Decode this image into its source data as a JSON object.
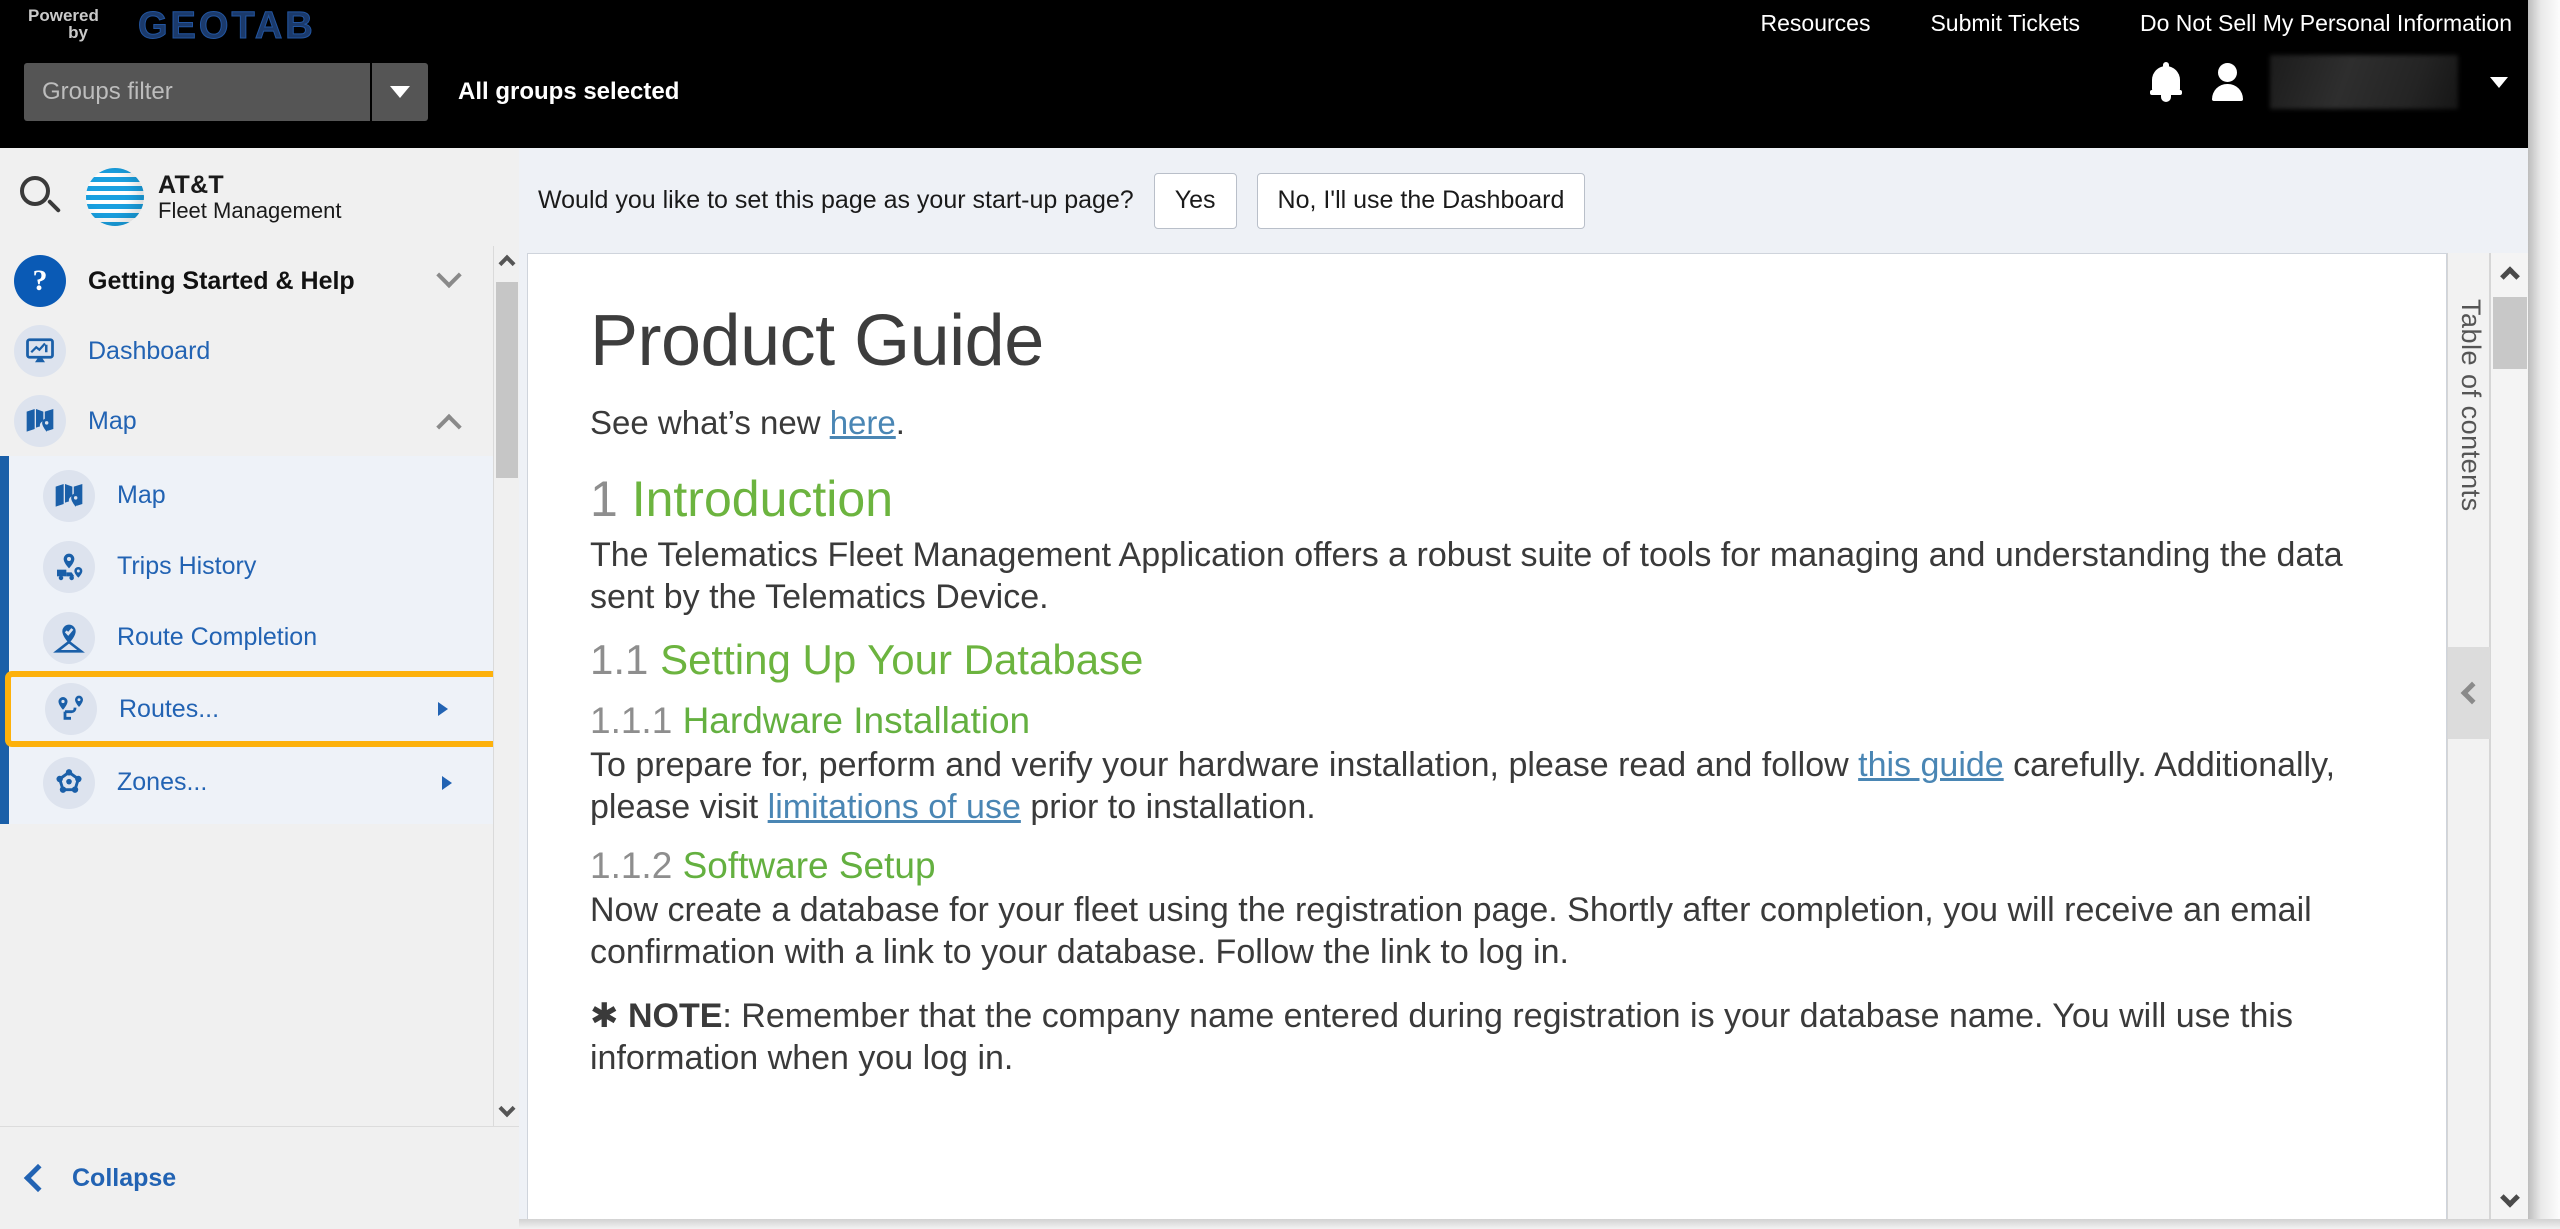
{
  "topbar": {
    "powered_line1": "Powered",
    "powered_line2": "by",
    "brand": "GEOTAB",
    "links": [
      "Resources",
      "Submit Tickets",
      "Do Not Sell My Personal Information"
    ],
    "groups_filter_placeholder": "Groups filter",
    "groups_filter_value": "",
    "groups_selected_label": "All groups selected",
    "notification_icon": "bell-icon",
    "user_icon": "person-icon",
    "user_name": ""
  },
  "sidebar": {
    "search_icon": "search-icon",
    "logo": {
      "icon": "att-globe-icon",
      "line1": "AT&T",
      "line2": "Fleet Management"
    },
    "items": [
      {
        "label": "Getting Started & Help",
        "icon": "question-circle-icon",
        "chevron": "chevron-down-icon",
        "bold": true
      },
      {
        "label": "Dashboard",
        "icon": "dashboard-icon",
        "chevron": "",
        "bold": false
      },
      {
        "label": "Map",
        "icon": "map-icon",
        "chevron": "chevron-up-icon",
        "bold": false
      }
    ],
    "submenu": [
      {
        "label": "Map",
        "icon": "map-icon",
        "arrow": ""
      },
      {
        "label": "Trips History",
        "icon": "trips-history-icon",
        "arrow": ""
      },
      {
        "label": "Route Completion",
        "icon": "route-completion-icon",
        "arrow": ""
      },
      {
        "label": "Routes...",
        "icon": "routes-icon",
        "arrow": "arrow-right-icon",
        "highlighted": true
      },
      {
        "label": "Zones...",
        "icon": "zones-icon",
        "arrow": "arrow-right-icon"
      }
    ],
    "collapse_label": "Collapse",
    "collapse_icon": "chevron-left-icon"
  },
  "startup_prompt": {
    "question": "Would you like to set this page as your start-up page?",
    "yes_label": "Yes",
    "no_label": "No, I'll use the Dashboard"
  },
  "document": {
    "title": "Product Guide",
    "subline_prefix": "See what’s new ",
    "subline_link": "here",
    "subline_suffix": ".",
    "sections": [
      {
        "number": "1",
        "title": "Introduction",
        "level": 1,
        "body": "The Telematics Fleet Management Application offers a robust suite of tools for managing and understanding the data sent by the Telematics Device."
      },
      {
        "number": "1.1",
        "title": "Setting Up Your Database",
        "level": 2,
        "body": ""
      },
      {
        "number": "1.1.1",
        "title": "Hardware Installation",
        "level": 3,
        "body_part1": "To prepare for, perform and verify your hardware installation, please read and follow ",
        "link1": "this guide",
        "body_part2": " carefully. Additionally, please visit ",
        "link2": "limitations of use",
        "body_part3": " prior to installation."
      },
      {
        "number": "1.1.2",
        "title": "Software Setup",
        "level": 3,
        "body": "Now create a database for your fleet using the registration page. Shortly after completion, you will receive an email confirmation with a link to your database. Follow the link to log in."
      }
    ],
    "note": {
      "star": "✱",
      "label": "NOTE",
      "text": ": Remember that the company name entered during registration is your database name. You will use this information when you log in."
    }
  },
  "toc": {
    "label": "Table of contents",
    "collapse_icon": "chevron-left-icon"
  },
  "colors": {
    "brand_blue": "#2263b3",
    "accent_green": "#6cb43f",
    "highlight_orange": "#fdb10b",
    "link_blue": "#4a86b4",
    "att_blue": "#1aa0e0"
  }
}
